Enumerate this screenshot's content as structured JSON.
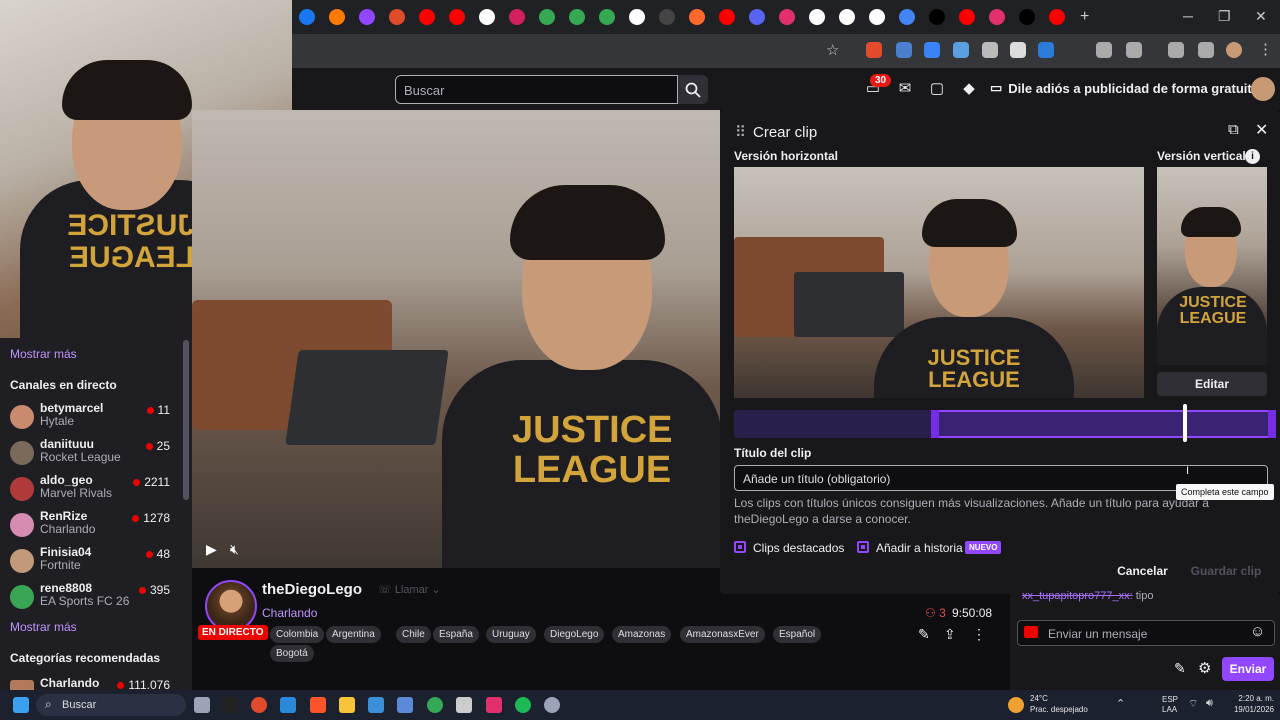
{
  "browser": {
    "window_controls": {
      "minimize": "─",
      "restore": "❐",
      "close": "✕"
    },
    "tab_icon_colors": [
      "#1877f2",
      "#ff7a00",
      "#9146ff",
      "#e04c2b",
      "#ff0000",
      "#ff0000",
      "#ffffff",
      "#d21f5f",
      "#34a853",
      "#34a853",
      "#34a853",
      "#ffffff",
      "#444444",
      "#ff6a2a",
      "#ff0000",
      "#5865f2",
      "#e1306c",
      "#ffffff",
      "#ffffff",
      "#ffffff",
      "#4285f4",
      "#000000",
      "#ff0000",
      "#e1306c",
      "#000000",
      "#ff0000"
    ],
    "new_tab_label": "+"
  },
  "twitch_nav": {
    "search_placeholder": "Buscar",
    "notifications_badge": "30",
    "promo_text": "Dile adiós a publicidad de forma gratuita"
  },
  "sidebar": {
    "show_more_top": "Mostrar más",
    "live_channels_heading": "Canales en directo",
    "channels": [
      {
        "name": "betymarcel",
        "game": "Hytale",
        "viewers": "11",
        "avatar_color": "#c98b6e"
      },
      {
        "name": "daniituuu",
        "game": "Rocket League",
        "viewers": "25",
        "avatar_color": "#7a6a5a"
      },
      {
        "name": "aldo_geo",
        "game": "Marvel Rivals",
        "viewers": "2211",
        "avatar_color": "#b03a3a"
      },
      {
        "name": "RenRize",
        "game": "Charlando",
        "viewers": "1278",
        "avatar_color": "#d68bb0"
      },
      {
        "name": "Finisia04",
        "game": "Fortnite",
        "viewers": "48",
        "avatar_color": "#c29a7a"
      },
      {
        "name": "rene8808",
        "game": "EA Sports FC 26",
        "viewers": "395",
        "avatar_color": "#3aa655"
      }
    ],
    "show_more_bottom": "Mostrar más",
    "recommended_heading": "Categorías recomendadas",
    "recommended_first": {
      "name": "Charlando",
      "viewers": "111.076"
    }
  },
  "stream": {
    "streamer": "theDiegoLego",
    "call_label": "Llamar",
    "category": "Charlando",
    "live_label": "EN DIRECTO",
    "viewer_count": "3",
    "uptime": "9:50:08",
    "tags": [
      "Colombia",
      "Argentina",
      "Chile",
      "España",
      "Uruguay",
      "DiegoLego",
      "Amazonas",
      "AmazonasxEver",
      "Español",
      "Bogotá"
    ]
  },
  "clip_panel": {
    "title": "Crear clip",
    "horizontal_label": "Versión horizontal",
    "vertical_label": "Versión vertical",
    "edit_label": "Editar",
    "clip_title_label": "Título del clip",
    "title_placeholder": "Añade un título (obligatorio)",
    "tooltip": "Completa este campo",
    "helper_text": "Los clips con títulos únicos consiguen más visualizaciones. Añade un título para ayudar a theDiegoLego a darse a conocer.",
    "option_featured": "Clips destacados",
    "option_story": "Añadir a historia",
    "new_badge": "NUEVO",
    "cancel_label": "Cancelar",
    "save_label": "Guardar clip"
  },
  "chat": {
    "last_message_user": "xx_tupapitopro777_xx:",
    "last_message_text": "tipo",
    "input_placeholder": "Enviar un mensaje",
    "send_label": "Enviar"
  },
  "taskbar": {
    "search_placeholder": "Buscar",
    "weather_temp": "24°C",
    "weather_desc": "Prac. despejado",
    "lang_line1": "ESP",
    "lang_line2": "LAA",
    "time": "2:20 a. m.",
    "date": "19/01/2026"
  },
  "colors": {
    "accent": "#9147ff",
    "live": "#eb0400",
    "bg": "#0e0e10"
  }
}
